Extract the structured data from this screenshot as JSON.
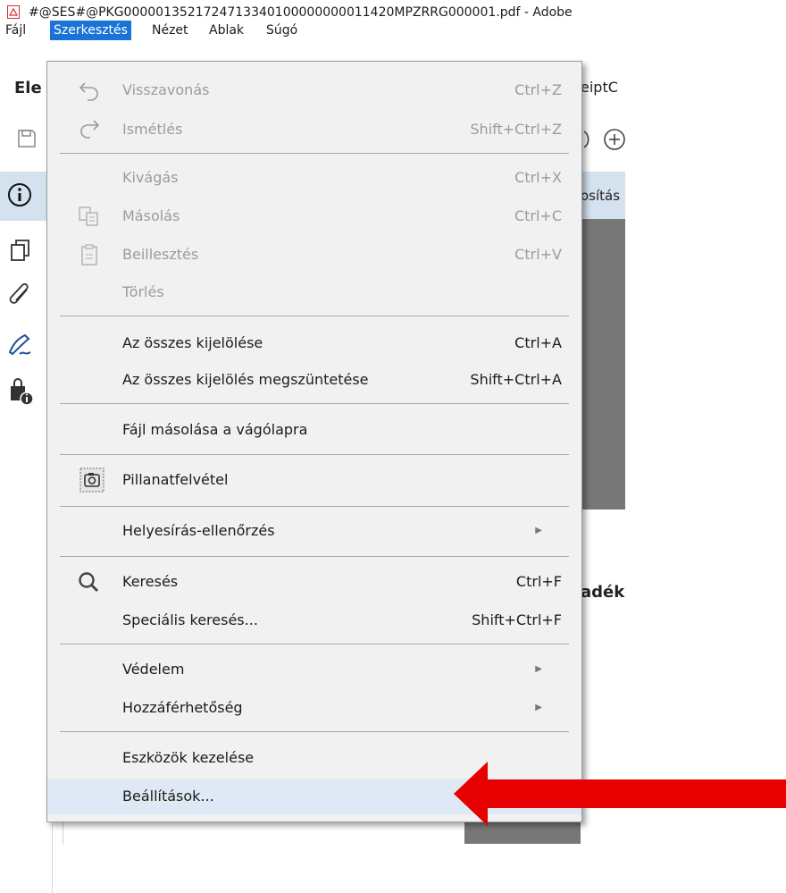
{
  "window": {
    "title": "#@SES#@PKG0000013521724713340100000000011420MPZRRG000001.pdf - Adobe"
  },
  "menubar": {
    "items": [
      {
        "label": "Fájl",
        "active": false
      },
      {
        "label": "Szerkesztés",
        "active": true
      },
      {
        "label": "Nézet",
        "active": false
      },
      {
        "label": "Ablak",
        "active": false
      },
      {
        "label": "Súgó",
        "active": false
      }
    ]
  },
  "background": {
    "tab_fragment": "Ele",
    "tab_fragment_right": "eiptC",
    "info_fragment": "osítás",
    "doc_fragment": "adék"
  },
  "dropdown": {
    "items": [
      {
        "label": "Visszavonás",
        "shortcut": "Ctrl+Z",
        "disabled": true,
        "icon": "undo-icon"
      },
      {
        "label": "Ismétlés",
        "shortcut": "Shift+Ctrl+Z",
        "disabled": true,
        "icon": "redo-icon"
      },
      {
        "label": "Kivágás",
        "shortcut": "Ctrl+X",
        "disabled": true
      },
      {
        "label": "Másolás",
        "shortcut": "Ctrl+C",
        "disabled": true,
        "icon": "copy-icon"
      },
      {
        "label": "Beillesztés",
        "shortcut": "Ctrl+V",
        "disabled": true,
        "icon": "paste-icon"
      },
      {
        "label": "Törlés",
        "shortcut": "",
        "disabled": true
      },
      {
        "label": "Az összes kijelölése",
        "shortcut": "Ctrl+A",
        "disabled": false
      },
      {
        "label": "Az összes kijelölés megszüntetése",
        "shortcut": "Shift+Ctrl+A",
        "disabled": false
      },
      {
        "label": "Fájl másolása a vágólapra",
        "shortcut": "",
        "disabled": false
      },
      {
        "label": "Pillanatfelvétel",
        "shortcut": "",
        "disabled": false,
        "icon": "camera-icon"
      },
      {
        "label": "Helyesírás-ellenőrzés",
        "shortcut": "",
        "disabled": false,
        "submenu": true
      },
      {
        "label": "Keresés",
        "shortcut": "Ctrl+F",
        "disabled": false,
        "icon": "search-icon"
      },
      {
        "label": "Speciális keresés...",
        "shortcut": "Shift+Ctrl+F",
        "disabled": false
      },
      {
        "label": "Védelem",
        "shortcut": "",
        "disabled": false,
        "submenu": true
      },
      {
        "label": "Hozzáférhetőség",
        "shortcut": "",
        "disabled": false,
        "submenu": true
      },
      {
        "label": "Eszközök kezelése",
        "shortcut": "",
        "disabled": false
      },
      {
        "label": "Beállítások...",
        "shortcut": "",
        "disabled": false,
        "highlighted": true
      }
    ]
  },
  "colors": {
    "menu_active": "#1a73d6",
    "highlight": "#dfe9f5",
    "arrow": "#e60000"
  }
}
